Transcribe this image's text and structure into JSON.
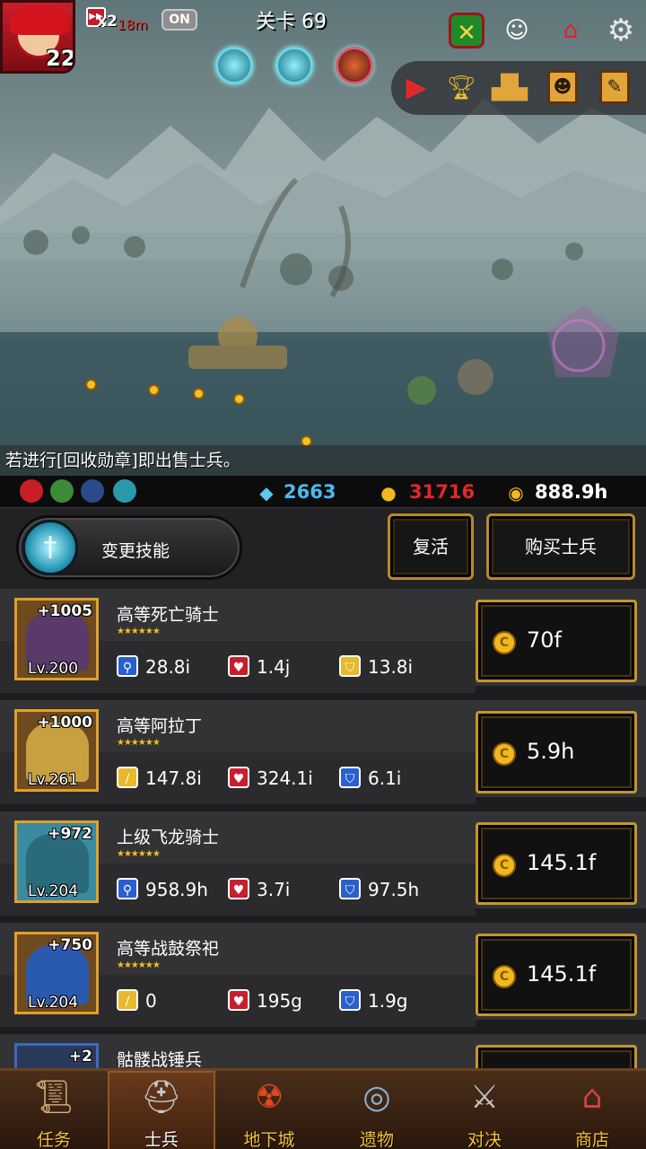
{
  "hud": {
    "player_level": "22",
    "speed_boost": {
      "multiplier": "x2",
      "time_left": "18m",
      "toggle": "ON"
    },
    "stage_label": "关卡 69"
  },
  "toolbar": {
    "icons": [
      "crest-shield-icon",
      "angel-icon",
      "shrine-house-icon",
      "settings-gear-icon"
    ],
    "panel_icons": [
      "play-icon",
      "trophy-icon",
      "ranking-podium-icon",
      "hero-book-icon",
      "quest-book-icon"
    ]
  },
  "notice": "若进行[回收勋章]即出售士兵。",
  "resources": {
    "gems": "2663",
    "medals": "31716",
    "gold": "888.9h"
  },
  "controls": {
    "skill_label": "变更技能",
    "revive_label": "复活",
    "buy_label": "购买士兵"
  },
  "soldiers": [
    {
      "name": "高等死亡骑士",
      "plus": "+1005",
      "level": "Lv.200",
      "stars": 6,
      "stats": [
        {
          "icon": "magnifier-icon",
          "value": "28.8i"
        },
        {
          "icon": "heart-icon",
          "value": "1.4j"
        },
        {
          "icon": "shield-icon",
          "value": "13.8i"
        }
      ],
      "price": "70f"
    },
    {
      "name": "高等阿拉丁",
      "plus": "+1000",
      "level": "Lv.261",
      "stars": 6,
      "stats": [
        {
          "icon": "sword-icon",
          "value": "147.8i"
        },
        {
          "icon": "heart-icon",
          "value": "324.1i"
        },
        {
          "icon": "shield-icon",
          "value": "6.1i"
        }
      ],
      "price": "5.9h"
    },
    {
      "name": "上级飞龙骑士",
      "plus": "+972",
      "level": "Lv.204",
      "stars": 6,
      "stats": [
        {
          "icon": "magnifier-icon",
          "value": "958.9h"
        },
        {
          "icon": "heart-icon",
          "value": "3.7i"
        },
        {
          "icon": "shield-icon",
          "value": "97.5h"
        }
      ],
      "price": "145.1f"
    },
    {
      "name": "高等战鼓祭祀",
      "plus": "+750",
      "level": "Lv.204",
      "stars": 6,
      "stats": [
        {
          "icon": "sword-icon",
          "value": "0"
        },
        {
          "icon": "heart-icon",
          "value": "195g"
        },
        {
          "icon": "shield-icon",
          "value": "1.9g"
        }
      ],
      "price": "145.1f"
    },
    {
      "name": "骷髅战锤兵",
      "plus": "+2",
      "level": "",
      "stars": 0,
      "stats": [],
      "price": ""
    }
  ],
  "nav": [
    {
      "label": "任务",
      "icon": "scroll-icon"
    },
    {
      "label": "士兵",
      "icon": "knight-helmet-icon"
    },
    {
      "label": "地下城",
      "icon": "monster-mouth-icon"
    },
    {
      "label": "遗物",
      "icon": "relic-orb-icon"
    },
    {
      "label": "对决",
      "icon": "crossed-swords-icon"
    },
    {
      "label": "商店",
      "icon": "shop-icon"
    }
  ],
  "colors": {
    "gold_border": "#c4962e",
    "gem_text": "#4fb8f0",
    "medal_text": "#e0282a",
    "gold_text": "#ffffff",
    "nav_label": "#f4c23a"
  }
}
